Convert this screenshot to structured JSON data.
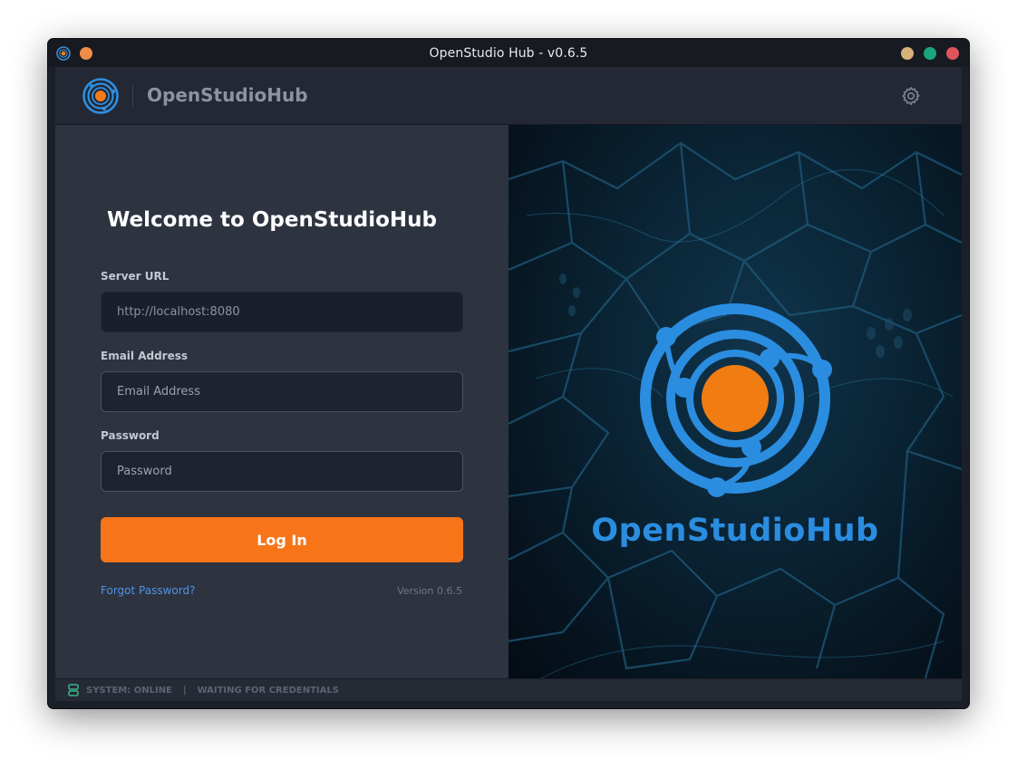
{
  "window": {
    "title": "OpenStudio Hub - v0.6.5",
    "controls": [
      "minimize",
      "maximize",
      "close"
    ]
  },
  "header": {
    "brand": "OpenStudioHub",
    "settings_icon": "gear-icon"
  },
  "login": {
    "heading": "Welcome to OpenStudioHub",
    "server_url_label": "Server URL",
    "server_url_placeholder": "http://localhost:8080",
    "email_label": "Email Address",
    "email_placeholder": "Email Address",
    "password_label": "Password",
    "password_placeholder": "Password",
    "login_button": "Log In",
    "forgot_password": "Forgot Password?",
    "version": "Version 0.6.5"
  },
  "hero": {
    "brand": "OpenStudioHub"
  },
  "status": {
    "system": "SYSTEM: ONLINE",
    "separator": "|",
    "state": "WAITING FOR CREDENTIALS"
  },
  "colors": {
    "accent": "#f77518",
    "brand_blue": "#2b8de0",
    "panel": "#2e3340",
    "link": "#4f93e6",
    "status_ok": "#3bb58a"
  }
}
